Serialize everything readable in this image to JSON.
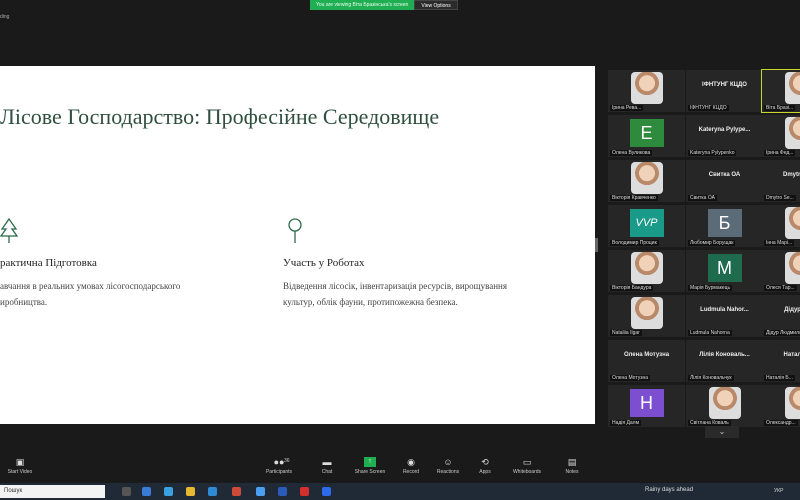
{
  "top": {
    "share_message": "You are viewing Віта Бразінська's screen",
    "view_options": "View Options",
    "recording_label": "ding"
  },
  "slide": {
    "title": "Лісове Господарство: Професійне Середовище",
    "left_heading": "рактична Підготовка",
    "left_text_1": "авчання в реальних умовах лісогосподарського",
    "left_text_2": "иробництва.",
    "right_heading": "Участь у Роботах",
    "right_text_1": "Відведення лісосік, інвентаризація ресурсів, вирощування",
    "right_text_2": "культур, облік фауни, протипожежна безпека.",
    "accent": "#2f6b4a"
  },
  "participants": [
    {
      "name": "Ірина Рева...",
      "type": "photo"
    },
    {
      "name": "ІФНТУНГ КЦДО",
      "type": "text",
      "center": "ІФНТУНГ КЦДО"
    },
    {
      "name": "Віта Бразі...",
      "type": "photo",
      "selected": true
    },
    {
      "name": "Олена Вуликова",
      "type": "letter",
      "letter": "E",
      "color": "#2e8b3e"
    },
    {
      "name": "Kateryna Pylypenko",
      "type": "text",
      "center": "Kateryna  Pylype..."
    },
    {
      "name": "Ірина Фед...",
      "type": "photo"
    },
    {
      "name": "Вікторія Кравченко",
      "type": "photo"
    },
    {
      "name": "Свитка ОА",
      "type": "text",
      "center": "Свитка ОА"
    },
    {
      "name": "Dmytro Se...",
      "type": "text",
      "center": "Dmytro Se..."
    },
    {
      "name": "Володимир Процик",
      "type": "letter",
      "letter": "VVP",
      "color": "#1a9b8a"
    },
    {
      "name": "Любомир Борущак",
      "type": "letter",
      "letter": "Б",
      "color": "#5b6b78"
    },
    {
      "name": "Інна Марі...",
      "type": "photo"
    },
    {
      "name": "Вікторія Бандура",
      "type": "photo"
    },
    {
      "name": "Марія Бурмакець",
      "type": "letter",
      "letter": "M",
      "color": "#1e6b4e"
    },
    {
      "name": "Олеся Тар...",
      "type": "photo"
    },
    {
      "name": "Nataliia Ilgar",
      "type": "photo"
    },
    {
      "name": "Ludmula Nahorna",
      "type": "text",
      "center": "Ludmula  Nahor..."
    },
    {
      "name": "Дідур Людмила",
      "type": "text",
      "center": "Дідур Лю..."
    },
    {
      "name": "Олена Мотузна",
      "type": "text",
      "center": "Олена Мотузна"
    },
    {
      "name": "Лілія Коновальчук",
      "type": "text",
      "center": "Лілія Коноваль..."
    },
    {
      "name": "Наталія Б...",
      "type": "text",
      "center": "Наталія Б..."
    },
    {
      "name": "Надія Далм",
      "type": "letter",
      "letter": "H",
      "color": "#7b4fd0"
    },
    {
      "name": "Світлана Коваль",
      "type": "photo"
    },
    {
      "name": "Олександр...",
      "type": "photo"
    }
  ],
  "more_button": "⌄",
  "toolbar": {
    "start_video": "Start Video",
    "participants": "Participants",
    "participants_count": "36",
    "chat": "Chat",
    "share_screen": "Share Screen",
    "record": "Record",
    "reactions": "Reactions",
    "apps": "Apps",
    "whiteboards": "Whiteboards",
    "notes": "Notes"
  },
  "taskbar": {
    "search_placeholder": "Пошук",
    "weather": "Rainy days ahead",
    "lang": "УКР"
  }
}
